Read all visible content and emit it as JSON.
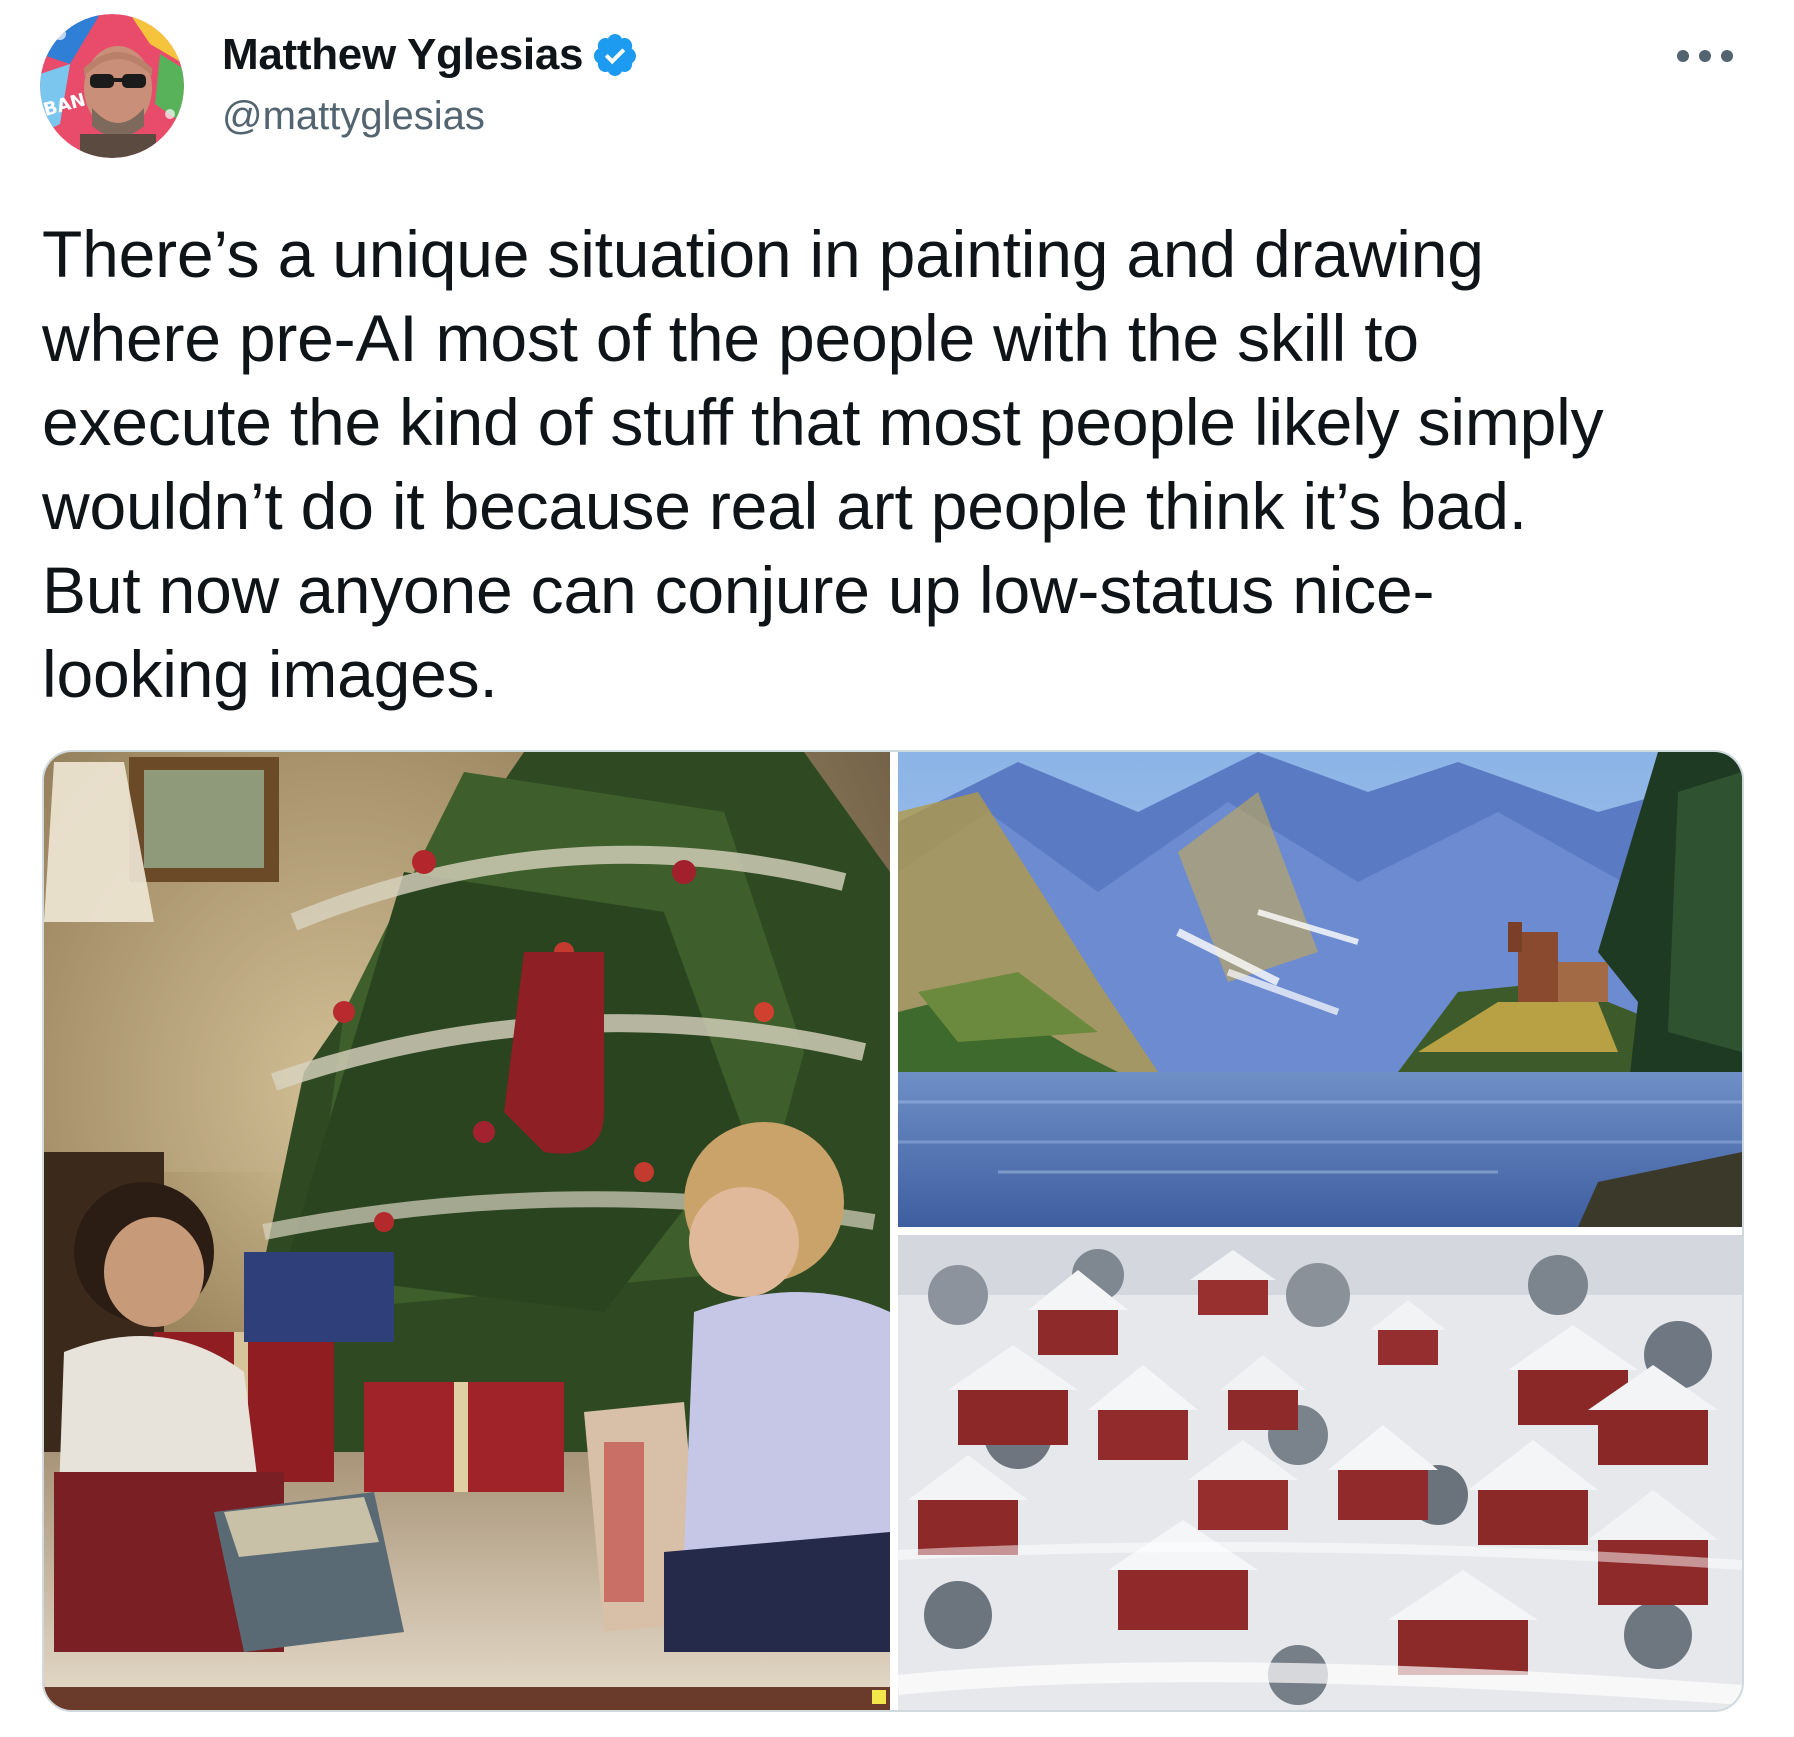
{
  "author": {
    "display_name": "Matthew Yglesias",
    "handle": "@mattyglesias",
    "verified": true,
    "avatar_icon": "avatar-image"
  },
  "menu": {
    "more_icon": "more-horizontal-icon"
  },
  "tweet": {
    "text": "There’s a unique situation in painting and drawing\nwhere pre-AI most of the people with the skill to\nexecute the kind of stuff that most people likely simply\nwouldn’t do it because real art people think it’s bad.\nBut now anyone can conjure up low-status nice-\nlooking images."
  },
  "colors": {
    "verified_blue": "#1d9bf0",
    "secondary_text": "#536471",
    "border": "#cfd9de"
  }
}
